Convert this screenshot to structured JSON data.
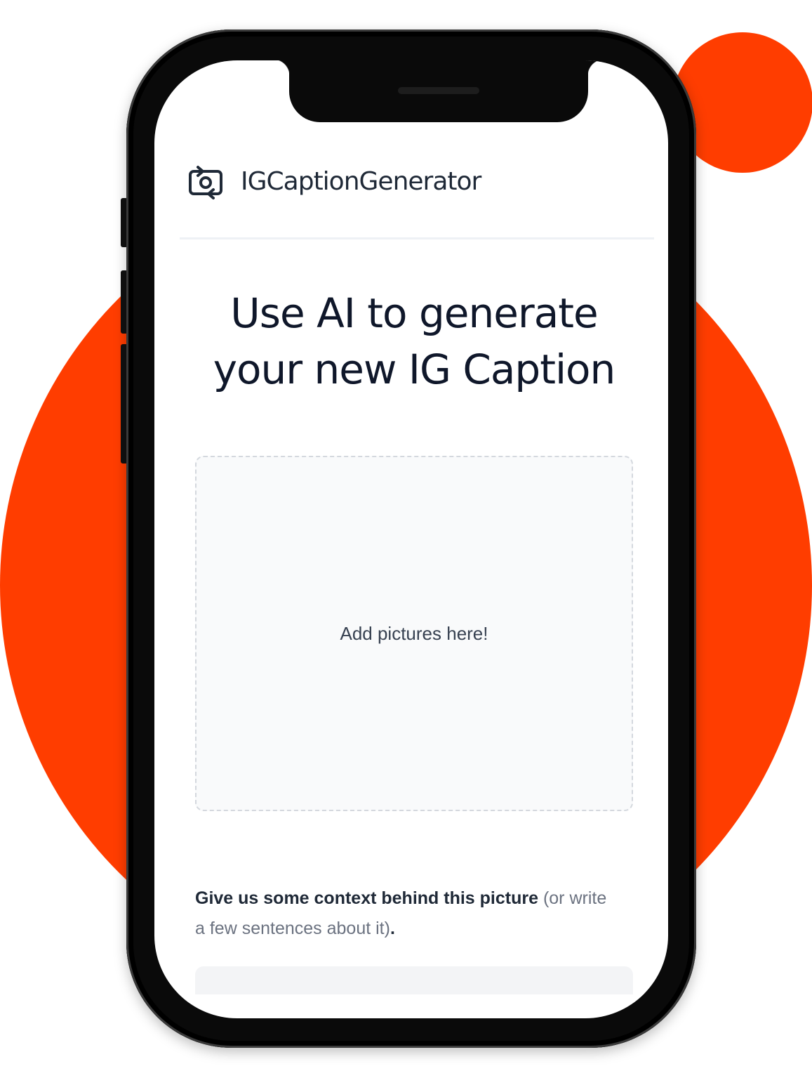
{
  "colors": {
    "accent": "#ff3d00",
    "phone_body": "#0a0a0a",
    "screen_bg": "#ffffff",
    "dropzone_bg": "#f9fafb"
  },
  "app": {
    "brand_name": "IGCaptionGenerator",
    "logo_icon": "camera-rotate-icon"
  },
  "main": {
    "headline_line1": "Use AI to generate",
    "headline_line2": "your new IG Caption",
    "dropzone_label": "Add pictures here!",
    "context_prompt_strong": "Give us some context behind this picture",
    "context_prompt_rest": "(or write a few sentences about it)",
    "context_prompt_end": "."
  }
}
